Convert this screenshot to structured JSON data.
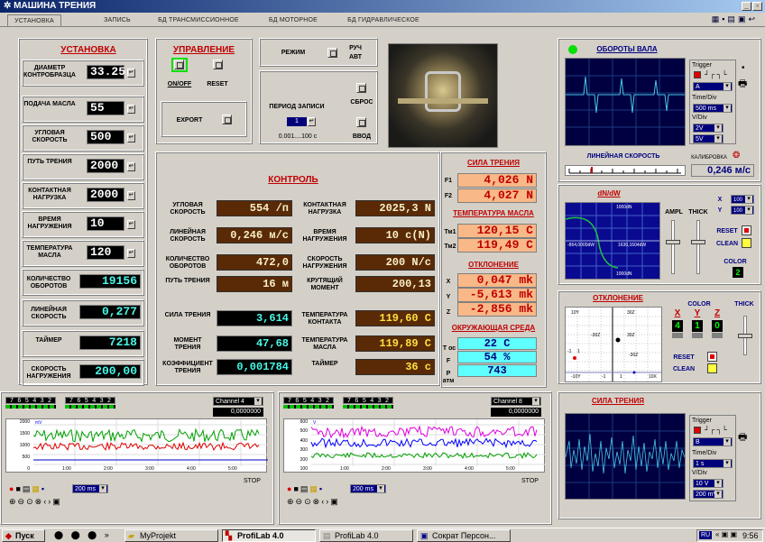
{
  "window": {
    "title": "МАШИНА ТРЕНИЯ"
  },
  "tabs": [
    "УСТАНОВКА",
    "ЗАПИСЬ",
    "БД ТРАНСМИССИОННОЕ",
    "БД МОТОРНОЕ",
    "БД ГИДРАВЛИЧЕСКОЕ"
  ],
  "setup": {
    "title": "УСТАНОВКА",
    "rows": [
      {
        "label": "ДИАМЕТР КОНТРОБРАЗЦА",
        "value": "33.25"
      },
      {
        "label": "ПОДАЧА МАСЛА",
        "value": "55"
      },
      {
        "label": "УГЛОВАЯ СКОРОСТЬ",
        "value": "500"
      },
      {
        "label": "ПУТЬ ТРЕНИЯ",
        "value": "2000"
      },
      {
        "label": "КОНТАКТНАЯ НАГРУЗКА",
        "value": "2000"
      },
      {
        "label": "ВРЕМЯ НАГРУЖЕНИЯ",
        "value": "10"
      },
      {
        "label": "ТЕМПЕРАТУРА МАСЛА",
        "value": "120"
      }
    ],
    "readouts": [
      {
        "label": "КОЛИЧЕСТВО ОБОРОТОВ",
        "value": "19156"
      },
      {
        "label": "ЛИНЕЙНАЯ СКОРОСТЬ",
        "value": "0,277"
      },
      {
        "label": "ТАЙМЕР",
        "value": "7218"
      },
      {
        "label": "СКОРОСТЬ НАГРУЖЕНИЯ",
        "value": "200,00"
      }
    ]
  },
  "control": {
    "title": "УПРАВЛЕНИЕ",
    "onoff": "ON/OFF",
    "reset": "RESET",
    "export": "EXPORT"
  },
  "mode": {
    "label": "РЕЖИМ",
    "opt1": "РУЧ",
    "opt2": "АВТ"
  },
  "period": {
    "label": "ПЕРИОД ЗАПИСИ",
    "value": "1",
    "range": "0.001....100 с"
  },
  "side_buttons": {
    "reset": "СБРОС",
    "input": "ВВОД"
  },
  "monitor": {
    "title": "КОНТРОЛЬ",
    "left": [
      {
        "label": "УГЛОВАЯ СКОРОСТЬ",
        "value": "554 /п"
      },
      {
        "label": "ЛИНЕЙНАЯ СКОРОСТЬ",
        "value": "0,246 м/с"
      },
      {
        "label": "КОЛИЧЕСТВО ОБОРОТОВ",
        "value": "472,0"
      },
      {
        "label": "ПУТЬ ТРЕНИЯ",
        "value": "16 м"
      }
    ],
    "right": [
      {
        "label": "КОНТАКТНАЯ НАГРУЗКА",
        "value": "2025,3 N"
      },
      {
        "label": "ВРЕМЯ НАГРУЖЕНИЯ",
        "value": "10 с(N)"
      },
      {
        "label": "СКОРОСТЬ НАГРУЖЕНИЯ",
        "value": "200 N/с"
      },
      {
        "label": "КРУТЯЩИЙ МОМЕНТ",
        "value": "200,13"
      }
    ],
    "left2": [
      {
        "label": "СИЛА ТРЕНИЯ",
        "value": "3,614"
      },
      {
        "label": "МОМЕНТ ТРЕНИЯ",
        "value": "47,68"
      },
      {
        "label": "КОЭФФИЦИЕНТ ТРЕНИЯ",
        "value": "0,001784"
      }
    ],
    "right2": [
      {
        "label": "ТЕМПЕРАТУРА КОНТАКТА",
        "value": "119,60 С"
      },
      {
        "label": "ТЕМПЕРАТУРА МАСЛА",
        "value": "119,89 С"
      },
      {
        "label": "ТАЙМЕР",
        "value": "36 с"
      }
    ]
  },
  "friction": {
    "title": "СИЛА ТРЕНИЯ",
    "f1_label": "F1",
    "f1": "4,026 N",
    "f2_label": "F2",
    "f2": "4,027 N"
  },
  "oiltemp": {
    "title": "ТЕМПЕРАТУРА МАСЛА",
    "t1_label": "Тм1",
    "t1": "120,15 С",
    "t2_label": "Тм2",
    "t2": "119,49 С"
  },
  "deviation": {
    "title": "ОТКЛОНЕНИЕ",
    "x_label": "X",
    "x": "0,047 mk",
    "y_label": "Y",
    "y": "-5,613 mk",
    "z_label": "Z",
    "z": "-2,856 mk"
  },
  "ambient": {
    "title": "ОКРУЖАЮЩАЯ СРЕДА",
    "t_label": "Т ос",
    "t": "22 С",
    "f_label": "F",
    "f": "54 %",
    "p_label": "Р атм",
    "p": "743"
  },
  "shaft": {
    "title": "ОБОРОТЫ ВАЛА",
    "trigger": "Trigger",
    "trig_sel": "A",
    "timediv": "Time/Div",
    "time_sel": "500 ms",
    "vdiv": "V/Div",
    "v1": "2V",
    "v2": "5V",
    "linspeed": "ЛИНЕЙНАЯ СКОРОСТЬ",
    "calib": "КАЛИБРОВКА",
    "speed_value": "0,246 м/с"
  },
  "dndw": {
    "title": "dN/dW",
    "top_lbl": "1000dN",
    "left_lbl": "-864,0000dW",
    "right_lbl": "1630,1604dW",
    "bot_lbl": "1000dN",
    "ampl": "AMPL",
    "thick": "THICK",
    "x_label": "X",
    "x_sel": "100",
    "y_label": "Y",
    "y_sel": "100",
    "reset": "RESET",
    "clean": "CLEAN",
    "color": "COLOR",
    "color_val": "2"
  },
  "deviation_plot": {
    "title": "ОТКЛОНЕНИЕ",
    "color": "COLOR",
    "thick": "THICK",
    "x": "X",
    "y": "Y",
    "z": "Z",
    "xv": "4",
    "yv": "1",
    "zv": "0",
    "reset": "RESET",
    "clean": "CLEAN",
    "g_tl": "10Y",
    "g_tr": "30Z",
    "g_ml": "-30Z",
    "g_mr": "30Z",
    "g_l1": "-1",
    "g_r1": "1",
    "g_bl": "-10Y",
    "g_b1": "-1",
    "g_b2": "1",
    "g_br": "10X",
    "g_mm": "-30Z"
  },
  "friction_scope": {
    "title": "СИЛА ТРЕНИЯ",
    "trigger": "Trigger",
    "trig_sel": "B",
    "timediv": "Time/Div",
    "time_sel": "1 s",
    "vdiv": "V/Div",
    "v1": "10 V",
    "v2": "200 mV"
  },
  "recorder1": {
    "bits": "7 6 5 4 3 2 1 0",
    "channel": "Channel 4",
    "value": "0,0000000",
    "ylabel": "mV",
    "y": [
      "2000",
      "1500",
      "1000",
      "500",
      "0"
    ],
    "x": [
      "1:00",
      "2:00",
      "3:00",
      "4:00",
      "5:00"
    ],
    "status": "STOP",
    "ms": "200 ms"
  },
  "recorder2": {
    "bits": "7 6 5 4 3 2 1 0",
    "channel": "Channel 8",
    "value": "0,0000000",
    "ylabel": "V",
    "y": [
      "600",
      "500",
      "400",
      "300",
      "200",
      "100"
    ],
    "x": [
      "1:00",
      "2:00",
      "3:00",
      "4:00",
      "5:00"
    ],
    "status": "STOP",
    "ms": "200 ms"
  },
  "taskbar": {
    "start": "Пуск",
    "items": [
      "MyProjekt",
      "ProfiLab 4.0",
      "ProfiLab 4.0",
      "Сократ Персон..."
    ],
    "lang": "RU",
    "clock": "9:56"
  },
  "colors": {
    "lcd_cyan": "#48f8e8",
    "lcd_brown": "#5a2a06",
    "lcd_orange": "#f8b888",
    "title_red": "#c00000",
    "scope_bg": "#000040"
  }
}
